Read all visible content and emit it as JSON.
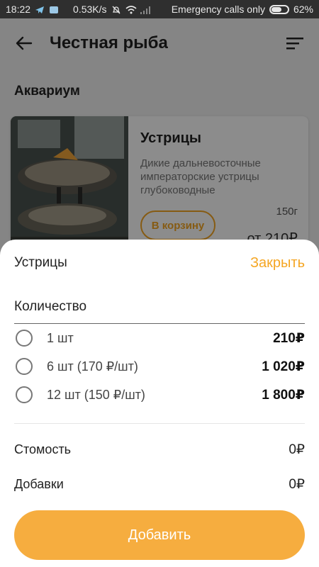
{
  "status_bar": {
    "time": "18:22",
    "speed": "0.53K/s",
    "carrier": "Emergency calls only",
    "battery": "62%",
    "battery_level": 0.62
  },
  "app": {
    "title": "Честная рыба",
    "section": "Аквариум",
    "card": {
      "name": "Устрицы",
      "description": "Дикие дальневосточные императорские устрицы глубоководные",
      "weight": "150г",
      "button_label": "В корзину",
      "price": "от 210₽"
    }
  },
  "sheet": {
    "title": "Устрицы",
    "close_label": "Закрыть",
    "quantity_label": "Количество",
    "options": [
      {
        "label": "1 шт",
        "price": "210₽"
      },
      {
        "label": "6 шт (170 ₽/шт)",
        "price": "1 020₽"
      },
      {
        "label": "12 шт (150 ₽/шт)",
        "price": "1 800₽"
      }
    ],
    "cost_label": "Стомость",
    "cost_value": "0₽",
    "addons_label": "Добавки",
    "addons_value": "0₽",
    "add_button": "Добавить"
  },
  "colors": {
    "accent": "#f5a623",
    "add_button": "#f6ad3f",
    "status_bar": "#2f2f2f"
  },
  "icons": [
    "back-arrow-icon",
    "filter-icon",
    "radio-unchecked-icon",
    "battery-icon",
    "wifi-icon",
    "mute-bell-icon"
  ]
}
